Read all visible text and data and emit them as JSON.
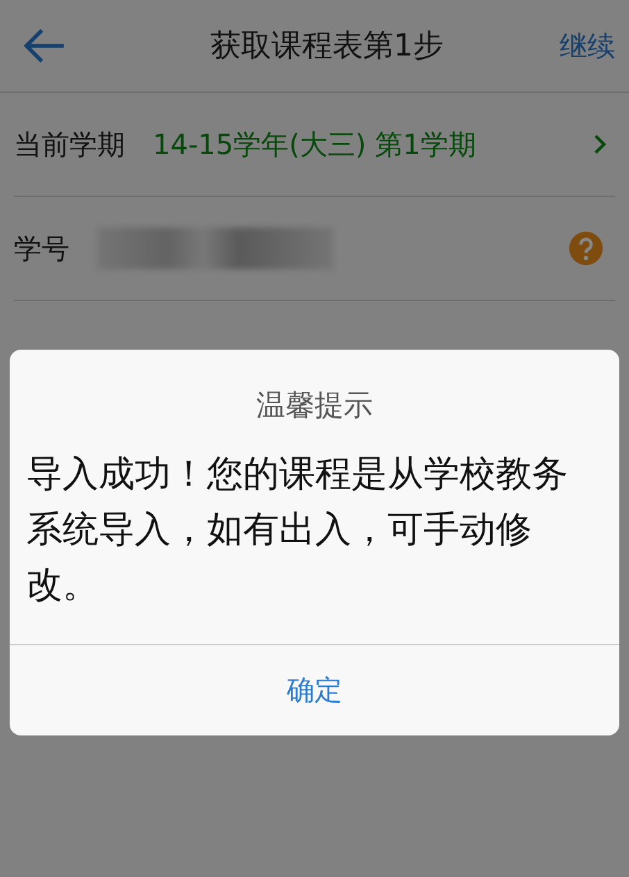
{
  "header": {
    "title": "获取课程表第1步",
    "action": "继续"
  },
  "rows": [
    {
      "kind": "select",
      "label": "当前学期",
      "value": "14-15学年(大三) 第1学期"
    },
    {
      "kind": "masked",
      "label": "学号"
    }
  ],
  "dialog": {
    "title": "温馨提示",
    "message": "导入成功！您的课程是从学校教务系统导入，如有出入，可手动修改。",
    "button": "确定"
  }
}
